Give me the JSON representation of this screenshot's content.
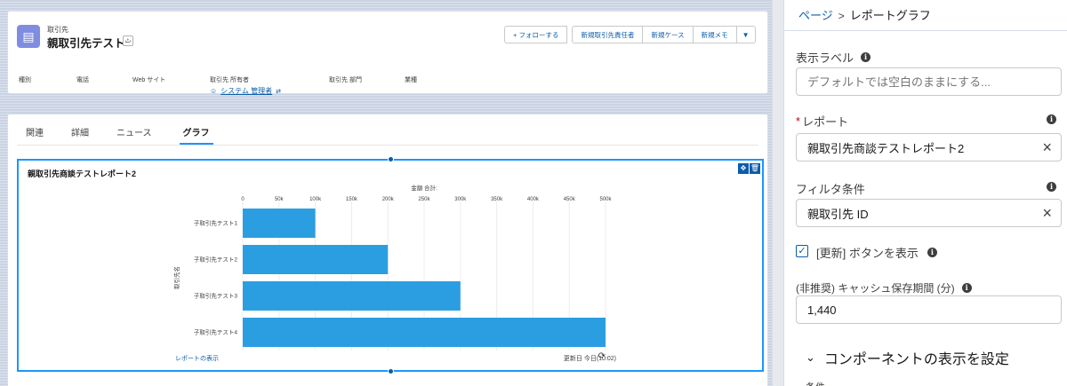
{
  "record": {
    "object_label": "取引先",
    "name": "親取引先テスト",
    "hierarchy_icon": "hierarchy-icon",
    "actions": [
      "+ フォローする",
      "新規取引先責任者",
      "新規ケース",
      "新規メモ"
    ],
    "dropdown_icon": "chevron-down-icon",
    "fields": {
      "type": "種別",
      "phone": "電話",
      "website": "Web サイト",
      "owner": "取引先 所有者",
      "division": "取引先 部門",
      "industry": "業種"
    },
    "owner_value": "システム 管理者"
  },
  "tabs": [
    "関連",
    "詳細",
    "ニュース",
    "グラフ"
  ],
  "active_tab": "グラフ",
  "component": {
    "title": "親取引先商談テストレポート2",
    "view_report": "レポートの表示",
    "updated": "更新日 今日(10:02)"
  },
  "chart_data": {
    "type": "bar",
    "orientation": "horizontal",
    "title": "親取引先商談テストレポート2",
    "xlabel": "金額 合計",
    "ylabel": "取引先名",
    "categories": [
      "子取引先テスト1",
      "子取引先テスト2",
      "子取引先テスト3",
      "子取引先テスト4"
    ],
    "values": [
      100000,
      200000,
      300000,
      500000
    ],
    "xticks": [
      "0",
      "50k",
      "100k",
      "150k",
      "200k",
      "250k",
      "300k",
      "350k",
      "400k",
      "450k",
      "500k"
    ],
    "xlim": [
      0,
      500000
    ],
    "bar_color": "#2b9ee2",
    "grid": true
  },
  "panel": {
    "breadcrumb_link": "ページ",
    "breadcrumb_sep": ">",
    "breadcrumb_current": "レポートグラフ",
    "label_field": {
      "label": "表示ラベル",
      "placeholder": "デフォルトでは空白のままにする..."
    },
    "report_field": {
      "label": "レポート",
      "value": "親取引先商談テストレポート2"
    },
    "filter_field": {
      "label": "フィルタ条件",
      "value": "親取引先 ID"
    },
    "refresh_checkbox": {
      "label": "[更新] ボタンを表示",
      "checked": true
    },
    "cache_field": {
      "label": "(非推奨) キャッシュ保存期間 (分)",
      "value": "1,440"
    },
    "visibility": "コンポーネントの表示を設定",
    "condition": "条件"
  }
}
